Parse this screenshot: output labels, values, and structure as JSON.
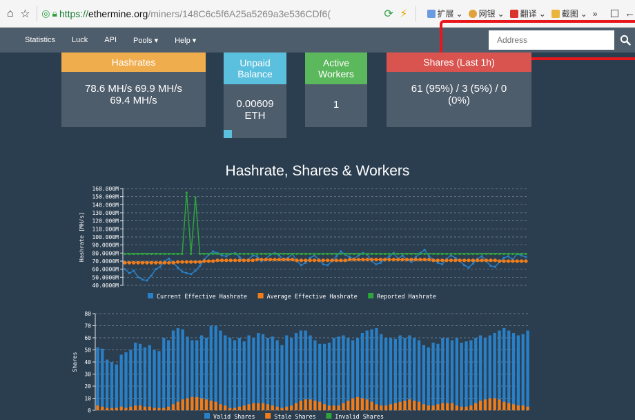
{
  "browser": {
    "url_scheme": "https://",
    "url_host": "ethermine.org",
    "url_path": "/miners/148C6c5f6A25a5269a3e536CDf6(",
    "extensions": [
      "扩展",
      "网银",
      "翻译",
      "截图"
    ],
    "more": "»"
  },
  "nav": {
    "items": [
      "Statistics",
      "Luck",
      "API",
      "Pools ▾",
      "Help ▾"
    ],
    "address_placeholder": "Address"
  },
  "cards": {
    "hashrates": {
      "title": "Hashrates",
      "value": "78.6 MH/s  69.9 MH/s 69.4 MH/s"
    },
    "unpaid": {
      "title": "Unpaid Balance",
      "value": "0.00609 ETH"
    },
    "workers": {
      "title": "Active Workers",
      "value": "1"
    },
    "shares": {
      "title": "Shares (Last 1h)",
      "value": "61 (95%) / 3 (5%) / 0 (0%)"
    }
  },
  "colors": {
    "blue": "#2a80c7",
    "orange": "#f07d1a",
    "green": "#2ea43a",
    "hash_header": "#f0ad4e",
    "unpaid_header": "#5bc0de",
    "workers_header": "#5cb85c",
    "shares_header": "#d9534f"
  },
  "chart_title": "Hashrate, Shares & Workers",
  "chart_data": [
    {
      "type": "line",
      "ylabel": "Hashrate [MH/s]",
      "ylim": [
        40,
        160
      ],
      "y_ticks": [
        "160.000M",
        "150.000M",
        "140.000M",
        "130.000M",
        "120.000M",
        "110.000M",
        "100.000M",
        "90.0000M",
        "80.0000M",
        "70.0000M",
        "60.0000M",
        "50.0000M",
        "40.0000M"
      ],
      "series": [
        {
          "name": "Current Effective Hashrate",
          "values": [
            60,
            55,
            58,
            50,
            47,
            46,
            52,
            60,
            63,
            70,
            73,
            68,
            62,
            57,
            55,
            54,
            58,
            64,
            72,
            78,
            82,
            80,
            77,
            76,
            79,
            80,
            75,
            70,
            72,
            77,
            76,
            70,
            73,
            78,
            80,
            77,
            72,
            74,
            79,
            70,
            65,
            68,
            74,
            77,
            72,
            66,
            65,
            70,
            76,
            82,
            78,
            75,
            73,
            77,
            80,
            78,
            70,
            66,
            68,
            72,
            76,
            80,
            73,
            77,
            72,
            69,
            75,
            80,
            84,
            76,
            72,
            68,
            66,
            73,
            77,
            74,
            70,
            65,
            62,
            67,
            73,
            76,
            70,
            64,
            63,
            69,
            74,
            76,
            72,
            79,
            77,
            75
          ]
        },
        {
          "name": "Average Effective Hashrate",
          "values": [
            68,
            68,
            68,
            68,
            68,
            68,
            68,
            68,
            68,
            68,
            68,
            68,
            69,
            69,
            69,
            69,
            69,
            69,
            70,
            70,
            70,
            71,
            71,
            71,
            71,
            71,
            71,
            71,
            71,
            71,
            72,
            72,
            72,
            72,
            72,
            72,
            72,
            72,
            72,
            71,
            71,
            71,
            71,
            71,
            71,
            71,
            71,
            71,
            71,
            71,
            71,
            72,
            72,
            72,
            72,
            72,
            72,
            72,
            72,
            72,
            72,
            72,
            72,
            72,
            72,
            72,
            72,
            72,
            72,
            72,
            71,
            71,
            71,
            71,
            71,
            71,
            71,
            71,
            71,
            71,
            71,
            71,
            71,
            71,
            71,
            70,
            70,
            70,
            70,
            70,
            70,
            70
          ]
        },
        {
          "name": "Reported Hashrate",
          "values": [
            79,
            79,
            79,
            79,
            79,
            79,
            79,
            79,
            79,
            79,
            79,
            79,
            79,
            79,
            155,
            79,
            149,
            79,
            79,
            79,
            79,
            79,
            79,
            79,
            79,
            79,
            79,
            79,
            79,
            79,
            79,
            79,
            79,
            79,
            79,
            79,
            79,
            79,
            79,
            79,
            79,
            79,
            79,
            79,
            79,
            79,
            79,
            79,
            79,
            79,
            79,
            79,
            79,
            79,
            79,
            79,
            79,
            79,
            79,
            79,
            79,
            79,
            79,
            79,
            79,
            79,
            79,
            79,
            79,
            79,
            79,
            79,
            79,
            79,
            79,
            79,
            79,
            79,
            79,
            79,
            79,
            79,
            79,
            79,
            79,
            79,
            79,
            79,
            79,
            79,
            79,
            79
          ]
        }
      ]
    },
    {
      "type": "bar",
      "ylabel": "Shares",
      "ylim": [
        0,
        80
      ],
      "y_ticks": [
        "80",
        "70",
        "60",
        "50",
        "40",
        "30",
        "20",
        "10",
        "0"
      ],
      "series": [
        {
          "name": "Valid Shares",
          "values": [
            52,
            51,
            42,
            40,
            38,
            46,
            48,
            50,
            56,
            55,
            52,
            54,
            50,
            49,
            60,
            58,
            66,
            68,
            67,
            61,
            58,
            58,
            62,
            60,
            70,
            70,
            66,
            62,
            60,
            58,
            60,
            57,
            62,
            60,
            64,
            63,
            60,
            61,
            58,
            54,
            62,
            60,
            64,
            66,
            66,
            62,
            58,
            55,
            55,
            56,
            60,
            61,
            62,
            60,
            58,
            60,
            64,
            66,
            67,
            68,
            63,
            60,
            60,
            59,
            62,
            60,
            62,
            60,
            58,
            54,
            52,
            56,
            55,
            60,
            60,
            58,
            60,
            56,
            57,
            58,
            60,
            62,
            60,
            62,
            64,
            66,
            68,
            66,
            64,
            62,
            63,
            66
          ]
        },
        {
          "name": "Stale Shares",
          "values": [
            4,
            3,
            2,
            2,
            2,
            3,
            2,
            3,
            4,
            4,
            3,
            3,
            2,
            2,
            2,
            3,
            5,
            7,
            9,
            10,
            11,
            11,
            10,
            9,
            8,
            7,
            5,
            4,
            2,
            2,
            3,
            4,
            5,
            6,
            6,
            6,
            5,
            4,
            3,
            2,
            3,
            4,
            6,
            8,
            9,
            9,
            8,
            7,
            5,
            4,
            4,
            4,
            6,
            8,
            10,
            11,
            10,
            9,
            7,
            5,
            4,
            4,
            5,
            6,
            7,
            8,
            9,
            8,
            7,
            5,
            4,
            4,
            5,
            6,
            6,
            6,
            4,
            3,
            3,
            4,
            6,
            8,
            9,
            10,
            10,
            9,
            7,
            6,
            5,
            4,
            4,
            3
          ]
        },
        {
          "name": "Invalid Shares",
          "values": []
        }
      ]
    }
  ]
}
